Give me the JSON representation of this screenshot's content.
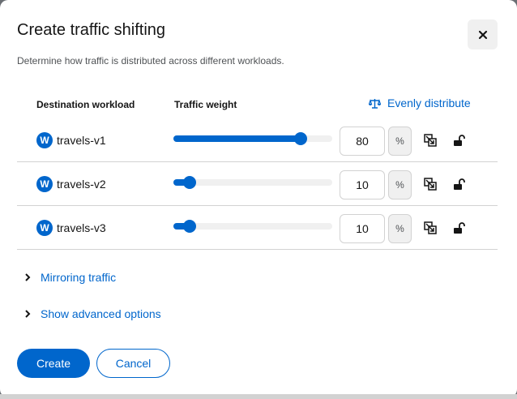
{
  "modal": {
    "title": "Create traffic shifting",
    "description": "Determine how traffic is distributed across different workloads."
  },
  "table": {
    "headers": {
      "destination": "Destination workload",
      "weight": "Traffic weight"
    },
    "evenly_distribute_label": "Evenly distribute",
    "rows": [
      {
        "badge": "W",
        "name": "travels-v1",
        "weight": "80",
        "unit": "%"
      },
      {
        "badge": "W",
        "name": "travels-v2",
        "weight": "10",
        "unit": "%"
      },
      {
        "badge": "W",
        "name": "travels-v3",
        "weight": "10",
        "unit": "%"
      }
    ]
  },
  "expanders": {
    "mirroring": "Mirroring traffic",
    "advanced": "Show advanced options"
  },
  "footer": {
    "create_label": "Create",
    "cancel_label": "Cancel"
  },
  "colors": {
    "accent": "#0066cc",
    "text": "#151515",
    "muted": "#4f5255",
    "border": "#d2d2d2"
  },
  "icons": {
    "close": "close-icon",
    "evenly": "balance-scale-icon",
    "link": "link-weights-icon",
    "lock": "unlock-icon",
    "expander": "chevron-right-icon"
  }
}
